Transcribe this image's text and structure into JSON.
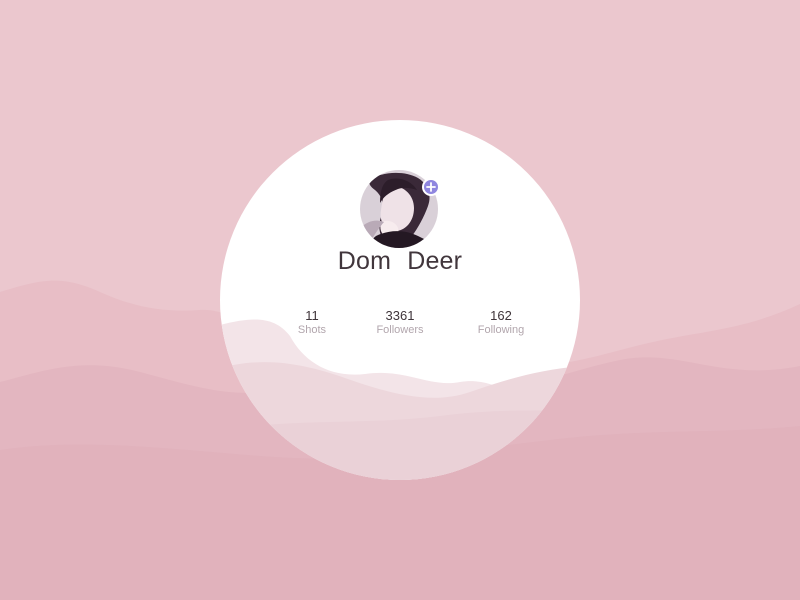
{
  "profile": {
    "first_name": "Dom",
    "last_name": "Deer",
    "avatar_alt": "profile avatar"
  },
  "stats": [
    {
      "value": "11",
      "label": "Shots"
    },
    {
      "value": "3361",
      "label": "Followers"
    },
    {
      "value": "162",
      "label": "Following"
    }
  ],
  "colors": {
    "page_background": "#ebc7ce",
    "card": "#ffffff",
    "accent": "#8f86df",
    "text_primary": "#41363c",
    "text_secondary": "#b2a6ad"
  },
  "icons": {
    "follow": "plus-icon",
    "avatar": "avatar"
  }
}
